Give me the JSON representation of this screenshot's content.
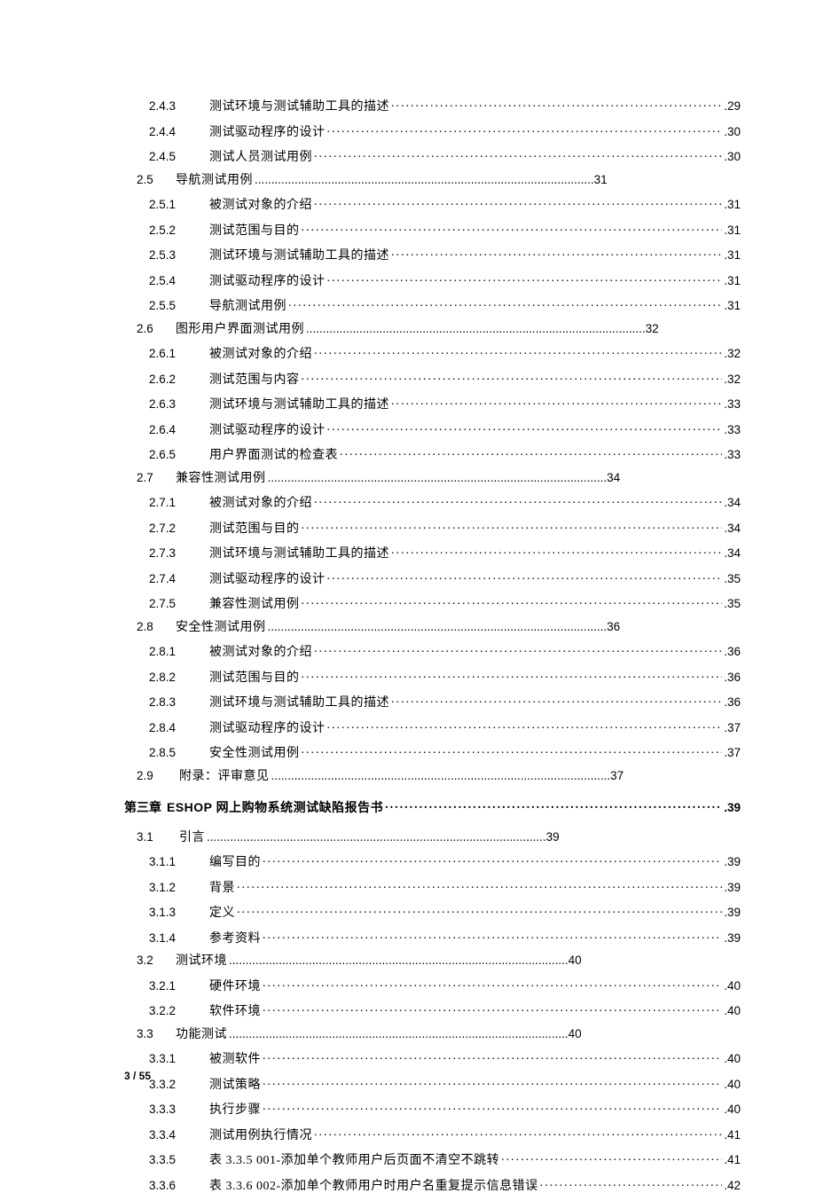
{
  "toc": [
    {
      "level": "level2",
      "num": "2.4.3",
      "title": "测试环境与测试辅助工具的描述",
      "page": "29"
    },
    {
      "level": "level2",
      "num": "2.4.4",
      "title": "测试驱动程序的设计",
      "page": "30"
    },
    {
      "level": "level2",
      "num": "2.4.5",
      "title": "测试人员测试用例",
      "page": "30",
      "ts": true
    },
    {
      "level": "level12",
      "num": "2.5",
      "title": "导航测试用例",
      "short_page": "31",
      "short": true
    },
    {
      "level": "level2",
      "num": "2.5.1",
      "title": "被测试对象的介绍",
      "page": "31",
      "ts": true
    },
    {
      "level": "level2",
      "num": "2.5.2",
      "title": "测试范围与目的",
      "page": "31"
    },
    {
      "level": "level2",
      "num": "2.5.3",
      "title": "测试环境与测试辅助工具的描述",
      "page": "31"
    },
    {
      "level": "level2",
      "num": "2.5.4",
      "title": "测试驱动程序的设计",
      "page": "31"
    },
    {
      "level": "level2",
      "num": "2.5.5",
      "title": "导航测试用例",
      "page": "31"
    },
    {
      "level": "level12",
      "num": "2.6",
      "title": "图形用户界面测试用例",
      "short_page": "32",
      "short": true
    },
    {
      "level": "level2",
      "num": "2.6.1",
      "title": "被测试对象的介绍",
      "page": "32",
      "ts": true
    },
    {
      "level": "level2",
      "num": "2.6.2",
      "title": "测试范围与内容",
      "page": "32"
    },
    {
      "level": "level2",
      "num": "2.6.3",
      "title": "测试环境与测试辅助工具的描述",
      "page": "33"
    },
    {
      "level": "level2",
      "num": "2.6.4",
      "title": "测试驱动程序的设计",
      "page": "33"
    },
    {
      "level": "level2",
      "num": "2.6.5",
      "title": "用户界面测试的检查表",
      "page": "33",
      "ts": true
    },
    {
      "level": "level12",
      "num": "2.7",
      "title": "兼容性测试用例",
      "short_page": "34",
      "short": true
    },
    {
      "level": "level2",
      "num": "2.7.1",
      "title": "被测试对象的介绍",
      "page": "34",
      "ts": true
    },
    {
      "level": "level2",
      "num": "2.7.2",
      "title": "测试范围与目的",
      "page": "34"
    },
    {
      "level": "level2",
      "num": "2.7.3",
      "title": "测试环境与测试辅助工具的描述",
      "page": "34"
    },
    {
      "level": "level2",
      "num": "2.7.4",
      "title": "测试驱动程序的设计",
      "page": "35"
    },
    {
      "level": "level2",
      "num": "2.7.5",
      "title": "兼容性测试用例",
      "page": "35",
      "ts": true
    },
    {
      "level": "level12",
      "num": "2.8",
      "title": "安全性测试用例",
      "short_page": "36",
      "short": true
    },
    {
      "level": "level2",
      "num": "2.8.1",
      "title": "被测试对象的介绍",
      "page": "36",
      "ts": true
    },
    {
      "level": "level2",
      "num": "2.8.2",
      "title": "测试范围与目的",
      "page": "36"
    },
    {
      "level": "level2",
      "num": "2.8.3",
      "title": "测试环境与测试辅助工具的描述",
      "page": "36"
    },
    {
      "level": "level2",
      "num": "2.8.4",
      "title": "测试驱动程序的设计",
      "page": "37"
    },
    {
      "level": "level2",
      "num": "2.8.5",
      "title": "安全性测试用例",
      "page": "37",
      "ts": true
    },
    {
      "level": "level1",
      "num": "2.9",
      "title": "附录：评审意见",
      "short_page": "37",
      "short": true,
      "ts": true
    },
    {
      "level": "chapter",
      "num": "第三章",
      "title": "ESHOP 网上购物系统测试缺陷报告书",
      "page": "39",
      "spacedBefore": true,
      "spacedAfter": true
    },
    {
      "level": "level1",
      "num": "3.1",
      "title": "引言",
      "short_page": "39",
      "short": true,
      "ts": true
    },
    {
      "level": "level2",
      "num": "3.1.1",
      "title": "编写目的",
      "page": "39"
    },
    {
      "level": "level2",
      "num": "3.1.2",
      "title": "背景",
      "page": "39",
      "ts": true
    },
    {
      "level": "level2",
      "num": "3.1.3",
      "title": "定义",
      "page": "39",
      "ts": true
    },
    {
      "level": "level2",
      "num": "3.1.4",
      "title": "参考资料",
      "page": "39"
    },
    {
      "level": "level12",
      "num": "3.2",
      "title": "测试环境",
      "short_page": "40",
      "short": true
    },
    {
      "level": "level2",
      "num": "3.2.1",
      "title": "硬件环境",
      "page": "40"
    },
    {
      "level": "level2",
      "num": "3.2.2",
      "title": "软件环境",
      "page": "40"
    },
    {
      "level": "level12",
      "num": "3.3",
      "title": "功能测试",
      "short_page": "40",
      "short": true
    },
    {
      "level": "level2",
      "num": "3.3.1",
      "title": "被测软件",
      "page": "40"
    },
    {
      "level": "level2",
      "num": "3.3.2",
      "title": "测试策略",
      "page": "40"
    },
    {
      "level": "level2",
      "num": "3.3.3",
      "title": "执行步骤",
      "page": "40"
    },
    {
      "level": "level2",
      "num": "3.3.4",
      "title": "测试用例执行情况",
      "page": "41",
      "ts": true
    },
    {
      "level": "level2",
      "num": "3.3.5",
      "title": "表 3.3.5 001-添加单个教师用户后页面不清空不跳转",
      "page": "41",
      "ts": true
    },
    {
      "level": "level2",
      "num": "3.3.6",
      "title": "表 3.3.6 002-添加单个教师用户时用户名重复提示信息错误",
      "page": "42",
      "ts": true
    }
  ],
  "short_leader": " ......................................................................................................",
  "footer": "3 / 55"
}
